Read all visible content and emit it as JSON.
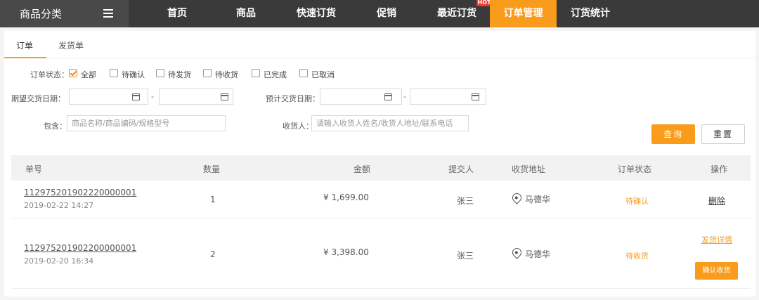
{
  "nav": {
    "category_label": "商品分类",
    "items": [
      {
        "label": "首页"
      },
      {
        "label": "商品"
      },
      {
        "label": "快速订货"
      },
      {
        "label": "促销"
      },
      {
        "label": "最近订货"
      },
      {
        "label": "订单管理"
      },
      {
        "label": "订货统计"
      }
    ],
    "hot_badge": "HOT",
    "active_item": "订单管理",
    "accent_color": "#f99c1c"
  },
  "tabs": [
    {
      "label": "订单"
    },
    {
      "label": "发货单"
    }
  ],
  "filters": {
    "status_label": "订单状态：",
    "statuses": [
      {
        "label": "全部",
        "checked": true
      },
      {
        "label": "待确认",
        "checked": false
      },
      {
        "label": "待发货",
        "checked": false
      },
      {
        "label": "待收货",
        "checked": false
      },
      {
        "label": "已完成",
        "checked": false
      },
      {
        "label": "已取消",
        "checked": false
      }
    ],
    "expected_date_label": "期望交货日期：",
    "estimated_date_label": "预计交货日期：",
    "date_separator": "-",
    "contains_label": "包含：",
    "contains_placeholder": "商品名称/商品编码/规格型号",
    "receiver_label": "收货人：",
    "receiver_placeholder": "请输入收货人姓名/收货人地址/联系电话",
    "query_button": "查询",
    "reset_button": "重置"
  },
  "table": {
    "headers": {
      "order_no": "单号",
      "quantity": "数量",
      "amount": "金额",
      "submitter": "提交人",
      "address": "收货地址",
      "status": "订单状态",
      "actions": "操作"
    },
    "rows": [
      {
        "order_no": "112975201902220000001",
        "date": "2019-02-22 14:27",
        "quantity": "1",
        "amount": "¥ 1,699.00",
        "submitter": "张三",
        "address": "马德华",
        "status": "待确认",
        "delete_action": "删除"
      },
      {
        "order_no": "112975201902200000001",
        "date": "2019-02-20 16:34",
        "quantity": "2",
        "amount": "¥ 3,398.00",
        "submitter": "张三",
        "address": "马德华",
        "status": "待收货",
        "detail_action": "发货详情",
        "confirm_action": "确认收货"
      }
    ]
  }
}
